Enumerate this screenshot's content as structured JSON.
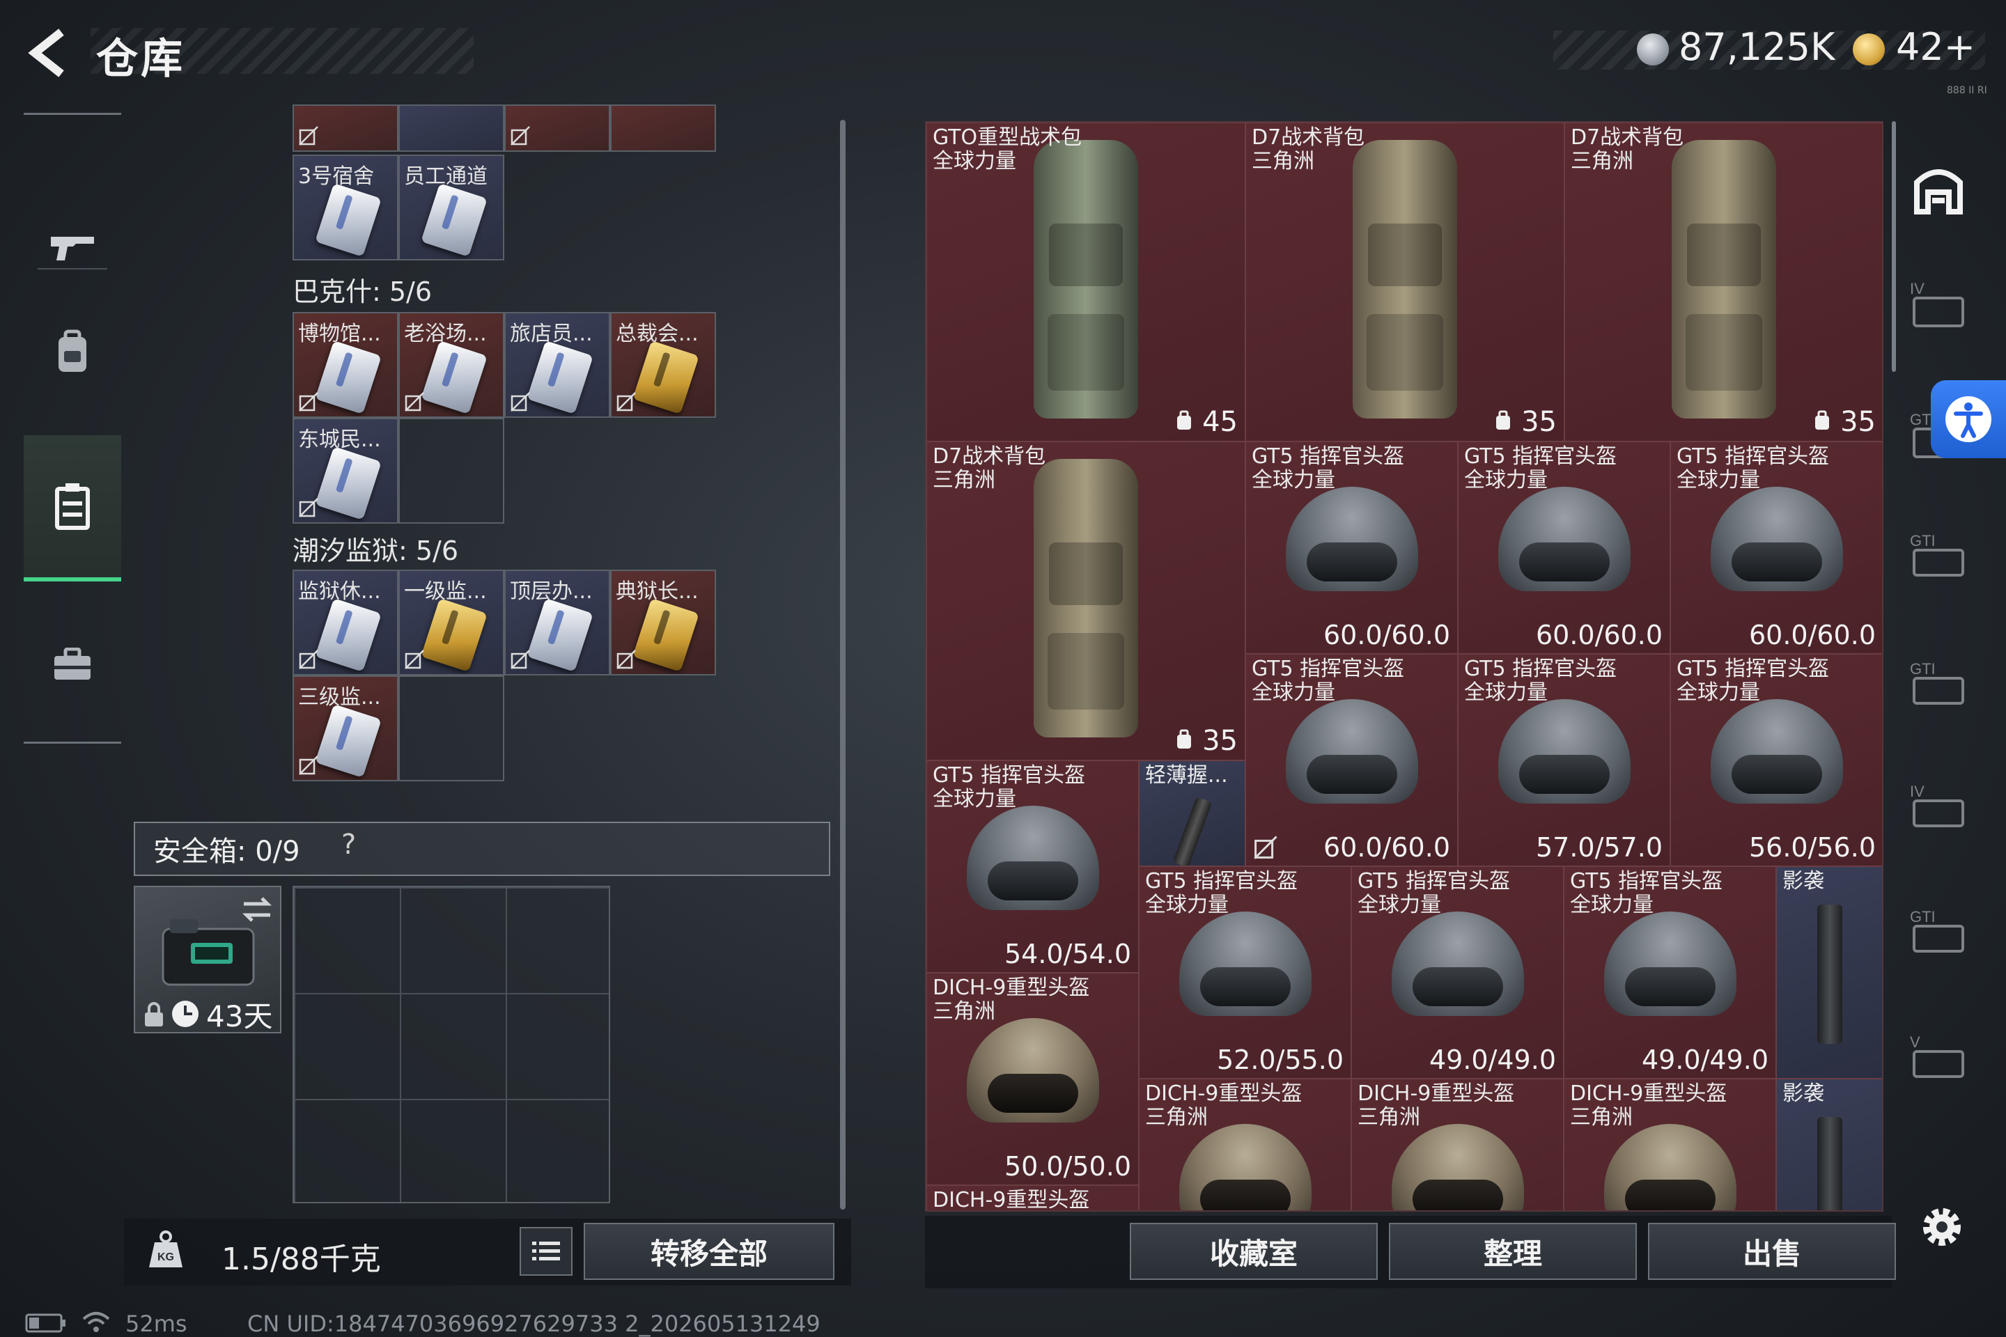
{
  "header": {
    "title": "仓库",
    "currency_silver": "87,125K",
    "currency_gold": "42+",
    "corner_tag": "888 II RI"
  },
  "left_nav": {
    "items": [
      {
        "icon": "gun-icon",
        "active": false
      },
      {
        "icon": "backpack-icon",
        "active": false
      },
      {
        "icon": "storage-box-icon",
        "active": true
      },
      {
        "icon": "briefcase-icon",
        "active": false
      }
    ]
  },
  "key_cards": {
    "top_partial": [
      {
        "name": ""
      },
      {
        "name": ""
      },
      {
        "name": ""
      },
      {
        "name": ""
      }
    ],
    "top_row": [
      {
        "name": "3号宿舍"
      },
      {
        "name": "员工通道"
      }
    ],
    "bakeshi": {
      "label": "巴克什: 5/6",
      "items": [
        {
          "name": "博物馆..."
        },
        {
          "name": "老浴场..."
        },
        {
          "name": "旅店员..."
        },
        {
          "name": "总裁会..."
        },
        {
          "name": "东城民..."
        }
      ]
    },
    "prison": {
      "label": "潮汐监狱: 5/6",
      "items": [
        {
          "name": "监狱休..."
        },
        {
          "name": "一级监..."
        },
        {
          "name": "顶层办..."
        },
        {
          "name": "典狱长..."
        },
        {
          "name": "三级监..."
        }
      ]
    }
  },
  "safe": {
    "label": "安全箱: 0/9",
    "help": "?",
    "days": "43天"
  },
  "bottom_left": {
    "weight": "1.5/88千克",
    "transfer_all": "转移全部"
  },
  "status": {
    "ping": "52ms",
    "uid": "CN UID:18474703696927629733 2_202605131249"
  },
  "stash": {
    "items": [
      {
        "name": "GTO重型战术包\n全球力量",
        "value": "45"
      },
      {
        "name": "D7战术背包\n三角洲",
        "value": "35"
      },
      {
        "name": "D7战术背包\n三角洲",
        "value": "35"
      },
      {
        "name": "D7战术背包\n三角洲",
        "value": "35"
      },
      {
        "name": "GT5 指挥官头盔\n全球力量",
        "value": "60.0/60.0"
      },
      {
        "name": "GT5 指挥官头盔\n全球力量",
        "value": "60.0/60.0"
      },
      {
        "name": "GT5 指挥官头盔\n全球力量",
        "value": "60.0/60.0"
      },
      {
        "name": "GT5 指挥官头盔\n全球力量",
        "value": "60.0/60.0"
      },
      {
        "name": "GT5 指挥官头盔\n全球力量",
        "value": "57.0/57.0"
      },
      {
        "name": "GT5 指挥官头盔\n全球力量",
        "value": "56.0/56.0"
      },
      {
        "name": "GT5 指挥官头盔\n全球力量",
        "value": "54.0/54.0"
      },
      {
        "name": "轻薄握...",
        "value": ""
      },
      {
        "name": "GT5 指挥官头盔\n全球力量",
        "value": "52.0/55.0"
      },
      {
        "name": "GT5 指挥官头盔\n全球力量",
        "value": "49.0/49.0"
      },
      {
        "name": "GT5 指挥官头盔\n全球力量",
        "value": "49.0/49.0"
      },
      {
        "name": "影袭",
        "value": ""
      },
      {
        "name": "DICH-9重型头盔\n三角洲",
        "value": "50.0/50.0"
      },
      {
        "name": "DICH-9重型头盔\n三角洲",
        "value": ""
      },
      {
        "name": "DICH-9重型头盔\n三角洲",
        "value": ""
      },
      {
        "name": "DICH-9重型头盔\n三角洲",
        "value": ""
      },
      {
        "name": "影袭",
        "value": ""
      },
      {
        "name": "DICH-9重型头盔",
        "value": ""
      }
    ]
  },
  "bottom_right": {
    "collection": "收藏室",
    "organize": "整理",
    "sell": "出售"
  },
  "right_tabs": [
    {
      "icon": "stash-home-icon",
      "active": true
    },
    {
      "icon": "storage-tab-iv-icon"
    },
    {
      "icon": "storage-tab-gt-icon"
    },
    {
      "icon": "storage-tab-gt-icon"
    },
    {
      "icon": "storage-tab-gt-icon"
    },
    {
      "icon": "storage-tab-iv-icon"
    },
    {
      "icon": "storage-tab-gt-icon"
    },
    {
      "icon": "storage-tab-v-icon"
    }
  ],
  "colors": {
    "accent_green": "#45d48a",
    "stash_bg": "#4a2228",
    "access_blue": "#3b82f6"
  }
}
